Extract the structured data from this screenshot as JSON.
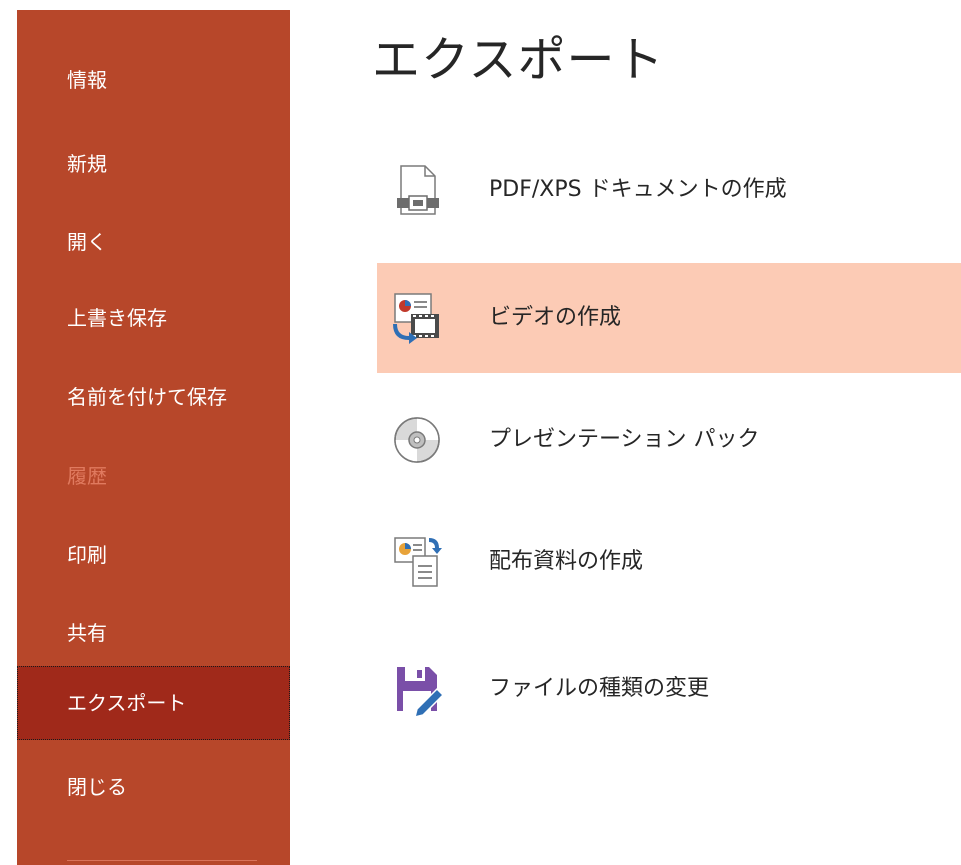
{
  "sidebar": {
    "items": [
      {
        "label": "情報",
        "state": "normal"
      },
      {
        "label": "新規",
        "state": "normal"
      },
      {
        "label": "開く",
        "state": "normal"
      },
      {
        "label": "上書き保存",
        "state": "normal"
      },
      {
        "label": "名前を付けて保存",
        "state": "normal"
      },
      {
        "label": "履歴",
        "state": "disabled"
      },
      {
        "label": "印刷",
        "state": "normal"
      },
      {
        "label": "共有",
        "state": "normal"
      },
      {
        "label": "エクスポート",
        "state": "selected"
      },
      {
        "label": "閉じる",
        "state": "normal"
      }
    ]
  },
  "main": {
    "title": "エクスポート",
    "options": [
      {
        "label": "PDF/XPS ドキュメントの作成",
        "icon": "pdf-document-icon"
      },
      {
        "label": "ビデオの作成",
        "icon": "video-icon"
      },
      {
        "label": "プレゼンテーション パック",
        "icon": "cd-icon"
      },
      {
        "label": "配布資料の作成",
        "icon": "handout-icon"
      },
      {
        "label": "ファイルの種類の変更",
        "icon": "file-type-icon"
      }
    ]
  },
  "colors": {
    "sidebar_bg": "#b7472a",
    "sidebar_selected": "#a0291a",
    "hover_bg": "#fccbb5",
    "disabled_text": "#e07a5f"
  }
}
